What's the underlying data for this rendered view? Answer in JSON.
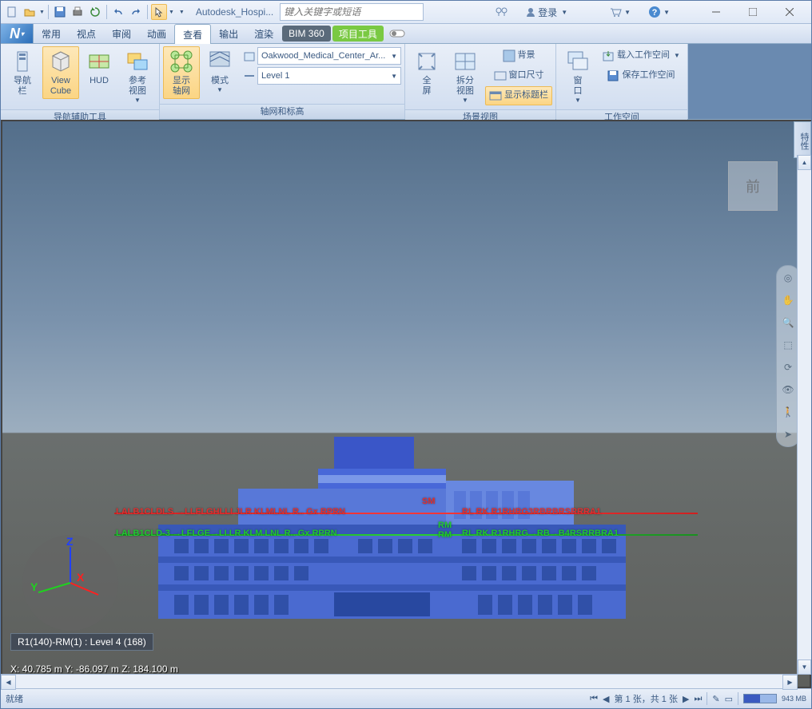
{
  "title": {
    "doc": "Autodesk_Hospi...",
    "search_placeholder": "键入关键字或短语",
    "login": "登录"
  },
  "tabs": {
    "common": "常用",
    "view": "视点",
    "review": "审阅",
    "anim": "动画",
    "look": "查看",
    "output": "输出",
    "render": "渲染",
    "bim": "BIM 360",
    "tools": "项目工具"
  },
  "ribbon": {
    "nav": {
      "bar": "导航\n栏",
      "viewcube": "View\nCube",
      "hud": "HUD",
      "refview": "参考\n视图",
      "panel": "导航辅助工具"
    },
    "grids": {
      "showgrid": "显示\n轴网",
      "mode": "模式",
      "file": "Oakwood_Medical_Center_Ar...",
      "level": "Level 1",
      "panel": "轴网和标高"
    },
    "scene": {
      "fullscreen": "全\n屏",
      "split": "拆分\n视图",
      "bg": "背景",
      "winsize": "窗口尺寸",
      "titlebar": "显示标题栏",
      "panel": "场景视图"
    },
    "workspace": {
      "window": "窗\n口",
      "load": "载入工作空间",
      "save": "保存工作空间",
      "panel": "工作空间"
    }
  },
  "viewport": {
    "cube": "前",
    "red_left": "LALB1CLDLS →LLFLGHLLI JLR KLMLNL R.. Gx RPRN",
    "red_mid": "SM",
    "red_right": "RL RK R1RHRG3RBRBRSRRRA1",
    "green_left": "LALB1CLD-3 →LFLGE→LI LR KLM LNL R.. Gx RPRN",
    "green_mid": "RM\nRM",
    "green_right": "RL RK R1RHRG→RB→B4RSRRBRA1",
    "sel": "R1(140)-RM(1) : Level 4 (168)",
    "coords": "X: 40.785 m  Y: -86.097 m  Z: 184.100 m",
    "props": "特性"
  },
  "status": {
    "ready": "就绪",
    "sheet": "第 1 张，共 1 张",
    "mem": "943 MB"
  }
}
